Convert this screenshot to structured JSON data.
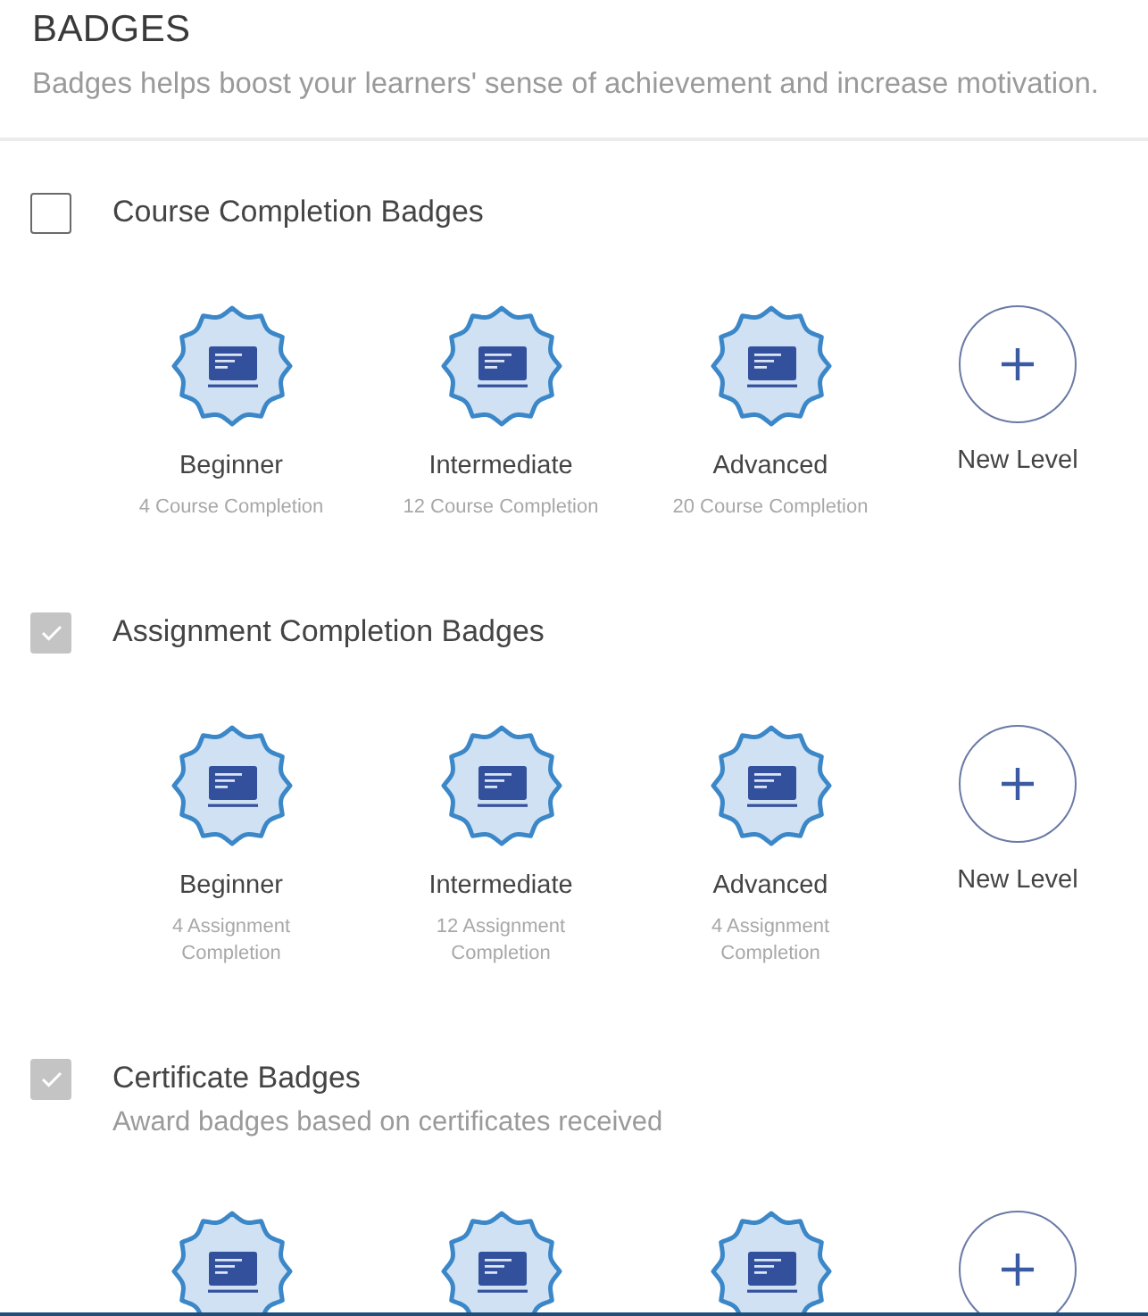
{
  "header": {
    "title": "BADGES",
    "subtitle": "Badges helps boost your learners' sense of achievement and increase motivation."
  },
  "sections": [
    {
      "title": "Course Completion Badges",
      "checked": false,
      "items": [
        {
          "kind": "badge",
          "name": "Beginner",
          "requirement": "4 Course Completion"
        },
        {
          "kind": "badge",
          "name": "Intermediate",
          "requirement": "12 Course Completion"
        },
        {
          "kind": "badge",
          "name": "Advanced",
          "requirement": "20 Course Completion"
        },
        {
          "kind": "add",
          "label": "New Level"
        }
      ]
    },
    {
      "title": "Assignment Completion Badges",
      "checked": true,
      "items": [
        {
          "kind": "badge",
          "name": "Beginner",
          "requirement": "4 Assignment Completion"
        },
        {
          "kind": "badge",
          "name": "Intermediate",
          "requirement": "12 Assignment Completion"
        },
        {
          "kind": "badge",
          "name": "Advanced",
          "requirement": "4 Assignment Completion"
        },
        {
          "kind": "add",
          "label": "New Level"
        }
      ]
    },
    {
      "title": "Certificate Badges",
      "checked": true,
      "description": "Award badges based on certificates received",
      "items": [
        {
          "kind": "badge"
        },
        {
          "kind": "badge"
        },
        {
          "kind": "badge"
        },
        {
          "kind": "add"
        }
      ]
    }
  ]
}
